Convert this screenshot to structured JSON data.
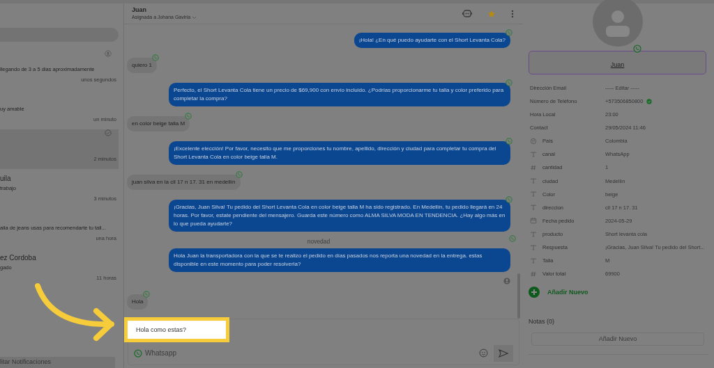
{
  "conversations": [
    {
      "preview": "llegando de 3 a 5 dias aproximadamente",
      "time": "unos segundos",
      "kind": "assigned",
      "selected": false
    },
    {
      "preview": "uy amable",
      "time": "un minuto",
      "selected": false
    },
    {
      "time": "2 minutos",
      "kind": "read",
      "selected": true
    },
    {
      "name": "uila",
      "preview": "trabajo",
      "time": "3 minutos",
      "selected": false
    },
    {
      "preview": "aila de jeans usas para recomendarte tu tall...",
      "time": "una hora",
      "selected": false
    },
    {
      "name": "ez Cordoba",
      "preview": "gado",
      "time": "11 horas",
      "selected": false
    }
  ],
  "notifications_button": "litar Notificaciones",
  "chat": {
    "name": "Juan",
    "assigned": "Asignada a Johana Gaviria",
    "messages": [
      {
        "kind": "outgoing",
        "text": "¡Hola! ¿En qué puedo ayudarte con el Short Levanta Cola?"
      },
      {
        "kind": "incoming",
        "text": "quiero 1"
      },
      {
        "kind": "outgoing",
        "text": "Perfecto, el Short Levanta Cola tiene un precio de $69,900 con envío incluido. ¿Podrías proporcionarme tu talla y color preferido para completar la compra?"
      },
      {
        "kind": "incoming",
        "text": "en color beige talla M"
      },
      {
        "kind": "outgoing",
        "text": "¡Excelente elección! Por favor, necesito que me proporciones tu nombre, apellido, dirección y ciudad para completar tu compra del Short Levanta Cola en color beige talla M."
      },
      {
        "kind": "incoming",
        "text": "juan silva en la cll 17 n 17. 31 en medellín"
      },
      {
        "kind": "outgoing",
        "text": "¡Gracias, Juan Silva! Tu pedido del Short Levanta Cola en color beige talla M ha sido registrado. En Medellín, tu pedido llegará en 24 horas. Por favor, estate pendiente del mensajero. Guarda este número como ALMA SILVA MODA EN TENDENCIA. ¿Hay algo más en lo que pueda ayudarte?"
      },
      {
        "kind": "template",
        "title": "novedad",
        "text": "Hola Juan la transportadora con la que se te realizo el pedido en días pasados nos reporta una novedad en la entrega. estas disponible en este momento para poder resolverla?"
      },
      {
        "kind": "incoming",
        "text": "Hola"
      }
    ],
    "composer": {
      "value": "Hola como estas?",
      "channel": "Whatsapp"
    }
  },
  "contact": {
    "name": "Juan",
    "fields": [
      {
        "label": "Dirección Email",
        "value": "----- Editar -----"
      },
      {
        "label": "Número de Teléfono",
        "value": "+573506850800",
        "verified": true
      },
      {
        "label": "Hora Local",
        "value": "23:00"
      },
      {
        "label": "Contact",
        "value": "29/05/2024 11:46"
      },
      {
        "kind": "country",
        "label": "País",
        "value": "Colombia"
      },
      {
        "kind": "text",
        "label": "canal",
        "value": "WhatsApp"
      },
      {
        "kind": "number",
        "label": "cantidad",
        "value": "1"
      },
      {
        "kind": "text",
        "label": "ciudad",
        "value": "Medellín"
      },
      {
        "kind": "text",
        "label": "Color",
        "value": "beige"
      },
      {
        "kind": "text",
        "label": "direccion",
        "value": "cll 17 n 17. 31"
      },
      {
        "kind": "date",
        "label": "Fecha pedido",
        "value": "2024-05-29"
      },
      {
        "kind": "text",
        "label": "producto",
        "value": "Short levanta cola"
      },
      {
        "kind": "text",
        "label": "Respuesta",
        "value": "¡Gracias, Juan Silva! Tu pedido del Short..."
      },
      {
        "kind": "text",
        "label": "Talla",
        "value": "M"
      },
      {
        "kind": "number",
        "label": "Valor total",
        "value": "69900"
      }
    ],
    "add_field": "Añadir Nuevo",
    "notes_title": "Notas (0)",
    "add_note": "Añadir Nuevo"
  }
}
